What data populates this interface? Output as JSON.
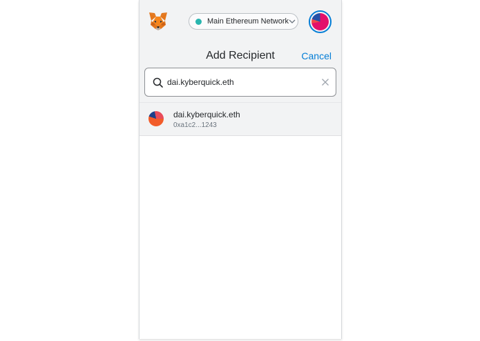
{
  "header": {
    "network": {
      "label": "Main Ethereum Network",
      "status_color": "#29b6af"
    },
    "logo_icon": "metamask-fox-icon",
    "account_icon": "account-identicon"
  },
  "page": {
    "title": "Add Recipient",
    "cancel_label": "Cancel"
  },
  "search": {
    "value": "dai.kyberquick.eth",
    "icon": "search-icon",
    "clear_icon": "close-icon"
  },
  "results": [
    {
      "name": "dai.kyberquick.eth",
      "address": "0xa1c2...1243"
    }
  ],
  "colors": {
    "accent": "#037dd6",
    "header_bg": "#f2f3f4",
    "text": "#24272a"
  }
}
